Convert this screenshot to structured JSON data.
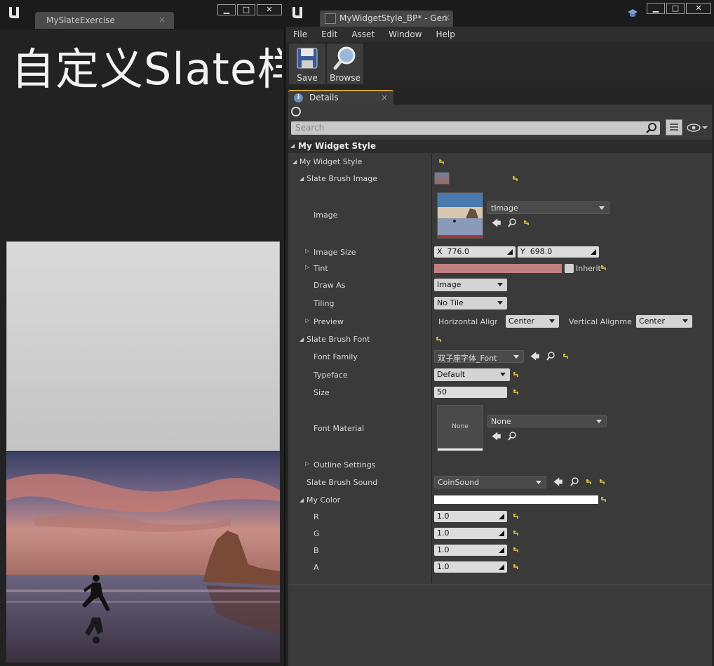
{
  "left_window": {
    "tab_title": "MySlateExercise",
    "tab_close": "×",
    "slate_title": "自定义Slate样",
    "buttons": {
      "minimize": "▁",
      "maximize": "□",
      "close": "✕"
    }
  },
  "right_window": {
    "tab_title": "MyWidgetStyle_BP* - Gen",
    "tab_close": "×",
    "buttons": {
      "minimize": "▁",
      "maximize": "□",
      "close": "✕"
    },
    "menu": [
      "File",
      "Edit",
      "Asset",
      "Window",
      "Help"
    ],
    "toolbar": {
      "save": "Save",
      "browse": "Browse"
    },
    "details_tab": {
      "label": "Details",
      "close": "×",
      "info": "i"
    },
    "search_placeholder": "Search",
    "section": "My Widget Style",
    "labels": {
      "my_widget_style": "My Widget Style",
      "slate_brush_image": "Slate Brush Image",
      "image": "Image",
      "image_size": "Image Size",
      "tint": "Tint",
      "draw_as": "Draw As",
      "tiling": "Tiling",
      "preview": "Preview",
      "slate_brush_font": "Slate Brush Font",
      "font_family": "Font Family",
      "typeface": "Typeface",
      "size": "Size",
      "font_material": "Font Material",
      "outline_settings": "Outline Settings",
      "slate_brush_sound": "Slate Brush Sound",
      "my_color": "My Color",
      "r": "R",
      "g": "G",
      "b": "B",
      "a": "A"
    },
    "values": {
      "image_asset": "tImage",
      "size_x_label": "X",
      "size_x": "776.0",
      "size_y_label": "Y",
      "size_y": "698.0",
      "tint_inherit": "Inherit",
      "tint_color": "#c08080",
      "draw_as": "Image",
      "tiling": "No Tile",
      "horizontal_align_label": "Horizontal Alignı",
      "horizontal_align": "Center",
      "vertical_align_label": "Vertical Alignme",
      "vertical_align": "Center",
      "font_family": "双子座字体_Font",
      "typeface": "Default",
      "size": "50",
      "font_material_tile": "None",
      "font_material": "None",
      "sound": "CoinSound",
      "my_color_swatch": "#ffffff",
      "r": "1.0",
      "g": "1.0",
      "b": "1.0",
      "a": "1.0"
    }
  },
  "colors": {
    "accent_tab": "#d8a43a",
    "reset_arrow": "#e8d23a"
  }
}
